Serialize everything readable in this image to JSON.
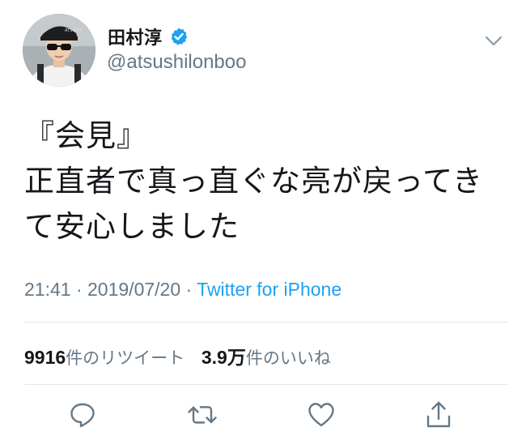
{
  "user": {
    "display_name": "田村淳",
    "handle": "@atsushilonboo",
    "verified": true,
    "verified_color": "#1da1f2"
  },
  "tweet": {
    "lines": [
      "『会見』",
      "正直者で真っ直ぐな亮が戻ってき",
      "て安心しました"
    ]
  },
  "meta": {
    "time": "21:41",
    "separator1": " · ",
    "date": "2019/07/20",
    "separator2": " · ",
    "source": "Twitter for iPhone"
  },
  "stats": {
    "retweets_count": "9916",
    "retweets_label": "件のリツイート",
    "likes_count": "3.9万",
    "likes_label": "件のいいね"
  },
  "actions": {
    "reply_icon": "reply-icon",
    "retweet_icon": "retweet-icon",
    "like_icon": "like-icon",
    "share_icon": "share-icon"
  },
  "colors": {
    "text": "#14171a",
    "secondary": "#657786",
    "link": "#1da1f2",
    "divider": "#e1e8ed"
  }
}
